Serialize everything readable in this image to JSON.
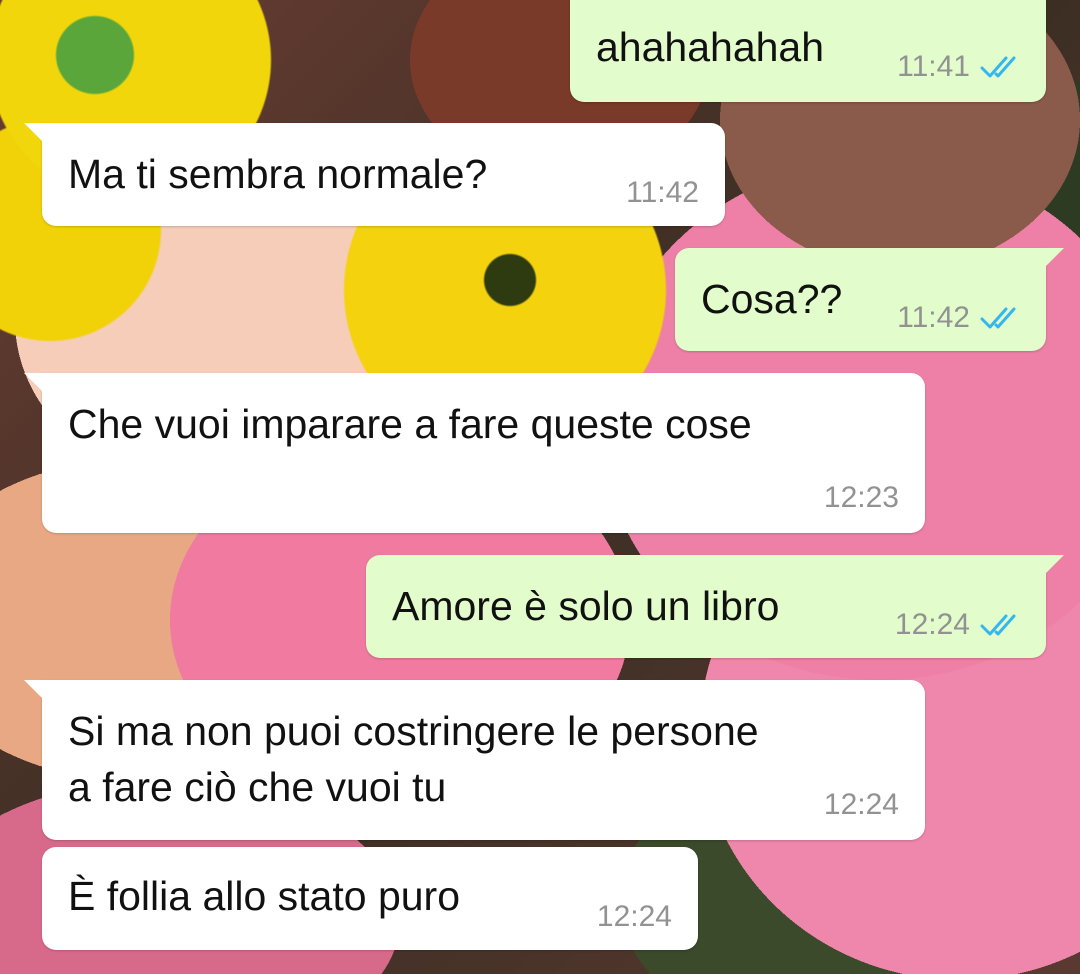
{
  "chat": {
    "colors": {
      "incoming_bubble": "#ffffff",
      "outgoing_bubble": "#e2fdcb",
      "timestamp": "#929292",
      "read_ticks": "#34b7f1"
    },
    "messages": [
      {
        "direction": "outgoing",
        "text": "ahahahahah",
        "time": "11:41",
        "status": "read"
      },
      {
        "direction": "incoming",
        "text": "Ma ti sembra normale?",
        "time": "11:42"
      },
      {
        "direction": "outgoing",
        "text": "Cosa??",
        "time": "11:42",
        "status": "read"
      },
      {
        "direction": "incoming",
        "text": "Che vuoi imparare a fare queste cose",
        "time": "12:23"
      },
      {
        "direction": "outgoing",
        "text": "Amore è solo un libro",
        "time": "12:24",
        "status": "read"
      },
      {
        "direction": "incoming",
        "text_line1": "Si ma non puoi costringere le persone",
        "text_line2": "a fare ciò che vuoi tu",
        "time": "12:24"
      },
      {
        "direction": "incoming",
        "text": "È follia allo stato puro",
        "time": "12:24"
      }
    ]
  }
}
